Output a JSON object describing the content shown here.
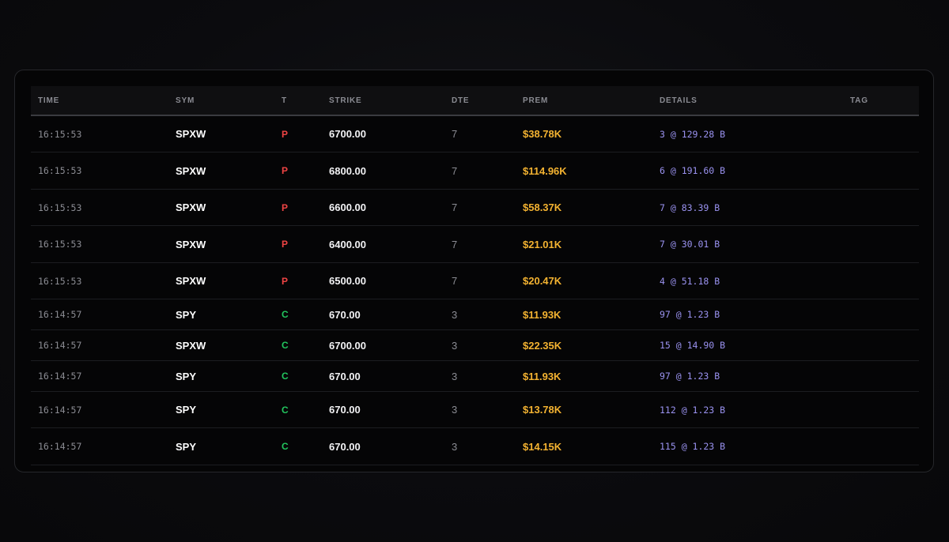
{
  "colors": {
    "put": "#ef4444",
    "call": "#22c55e",
    "premium": "#f4b331",
    "details": "#9a92f0"
  },
  "table": {
    "headers": {
      "time": "TIME",
      "sym": "SYM",
      "type": "T",
      "strike": "STRIKE",
      "dte": "DTE",
      "prem": "PREM",
      "details": "DETAILS",
      "tag": "TAG"
    },
    "rows": [
      {
        "time": "16:15:53",
        "sym": "SPXW",
        "type": "P",
        "strike": "6700.00",
        "dte": "7",
        "prem": "$38.78K",
        "details": "3 @ 129.28 B",
        "tag": ""
      },
      {
        "time": "16:15:53",
        "sym": "SPXW",
        "type": "P",
        "strike": "6800.00",
        "dte": "7",
        "prem": "$114.96K",
        "details": "6 @ 191.60 B",
        "tag": ""
      },
      {
        "time": "16:15:53",
        "sym": "SPXW",
        "type": "P",
        "strike": "6600.00",
        "dte": "7",
        "prem": "$58.37K",
        "details": "7 @ 83.39 B",
        "tag": ""
      },
      {
        "time": "16:15:53",
        "sym": "SPXW",
        "type": "P",
        "strike": "6400.00",
        "dte": "7",
        "prem": "$21.01K",
        "details": "7 @ 30.01 B",
        "tag": ""
      },
      {
        "time": "16:15:53",
        "sym": "SPXW",
        "type": "P",
        "strike": "6500.00",
        "dte": "7",
        "prem": "$20.47K",
        "details": "4 @ 51.18 B",
        "tag": ""
      },
      {
        "time": "16:14:57",
        "sym": "SPY",
        "type": "C",
        "strike": "670.00",
        "dte": "3",
        "prem": "$11.93K",
        "details": "97 @ 1.23 B",
        "tag": ""
      },
      {
        "time": "16:14:57",
        "sym": "SPXW",
        "type": "C",
        "strike": "6700.00",
        "dte": "3",
        "prem": "$22.35K",
        "details": "15 @ 14.90 B",
        "tag": ""
      },
      {
        "time": "16:14:57",
        "sym": "SPY",
        "type": "C",
        "strike": "670.00",
        "dte": "3",
        "prem": "$11.93K",
        "details": "97 @ 1.23 B",
        "tag": ""
      },
      {
        "time": "16:14:57",
        "sym": "SPY",
        "type": "C",
        "strike": "670.00",
        "dte": "3",
        "prem": "$13.78K",
        "details": "112 @ 1.23 B",
        "tag": ""
      },
      {
        "time": "16:14:57",
        "sym": "SPY",
        "type": "C",
        "strike": "670.00",
        "dte": "3",
        "prem": "$14.15K",
        "details": "115 @ 1.23 B",
        "tag": ""
      }
    ]
  }
}
